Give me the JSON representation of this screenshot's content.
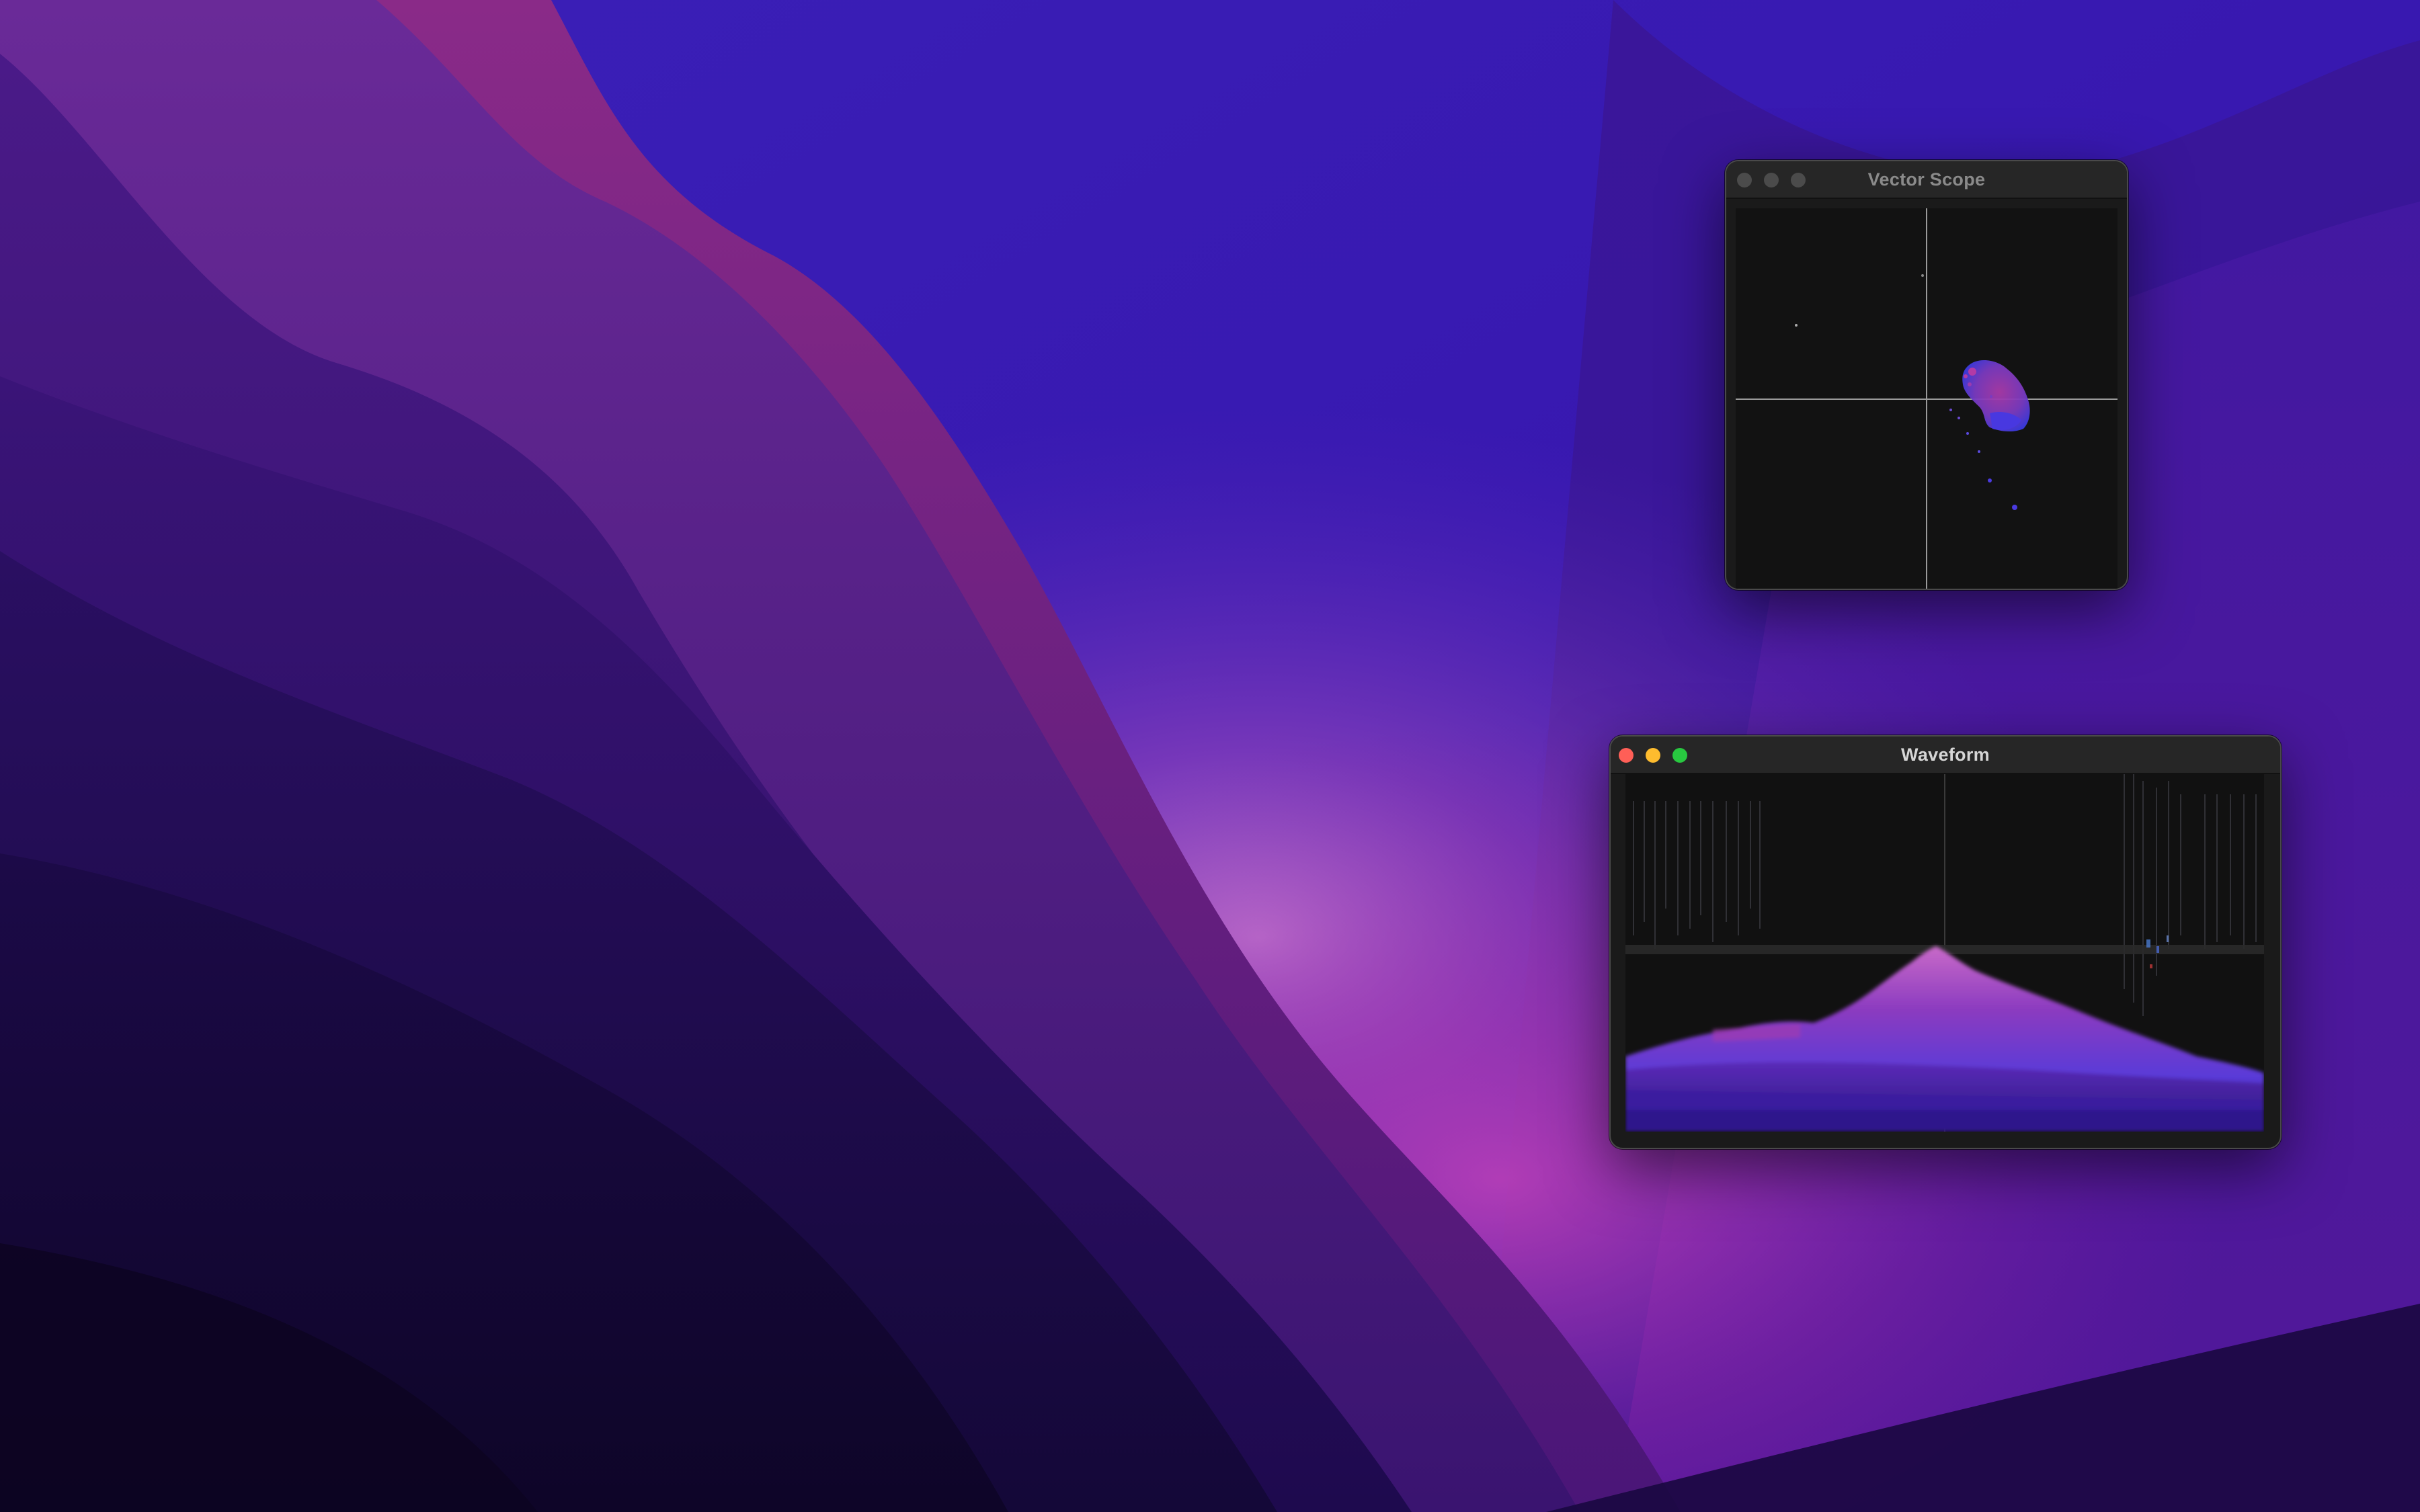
{
  "desktop": {
    "wallpaper_colors": {
      "deep": "#120830",
      "indigo": "#2a1aa8",
      "violet": "#5a2ab8",
      "magenta": "#9a2aa0",
      "glow": "#c070d0"
    }
  },
  "windows": {
    "vector_scope": {
      "title": "Vector Scope",
      "state": "inactive",
      "buttons": [
        "close",
        "minimize",
        "zoom"
      ]
    },
    "waveform": {
      "title": "Waveform",
      "state": "active",
      "buttons": [
        "close",
        "minimize",
        "zoom"
      ]
    }
  },
  "colors": {
    "window_bg": "#1a1a1a",
    "titlebar_bg": "#262626",
    "scope_bg": "#121212",
    "graticule": "#8a8a8a",
    "trace_magenta": "#b23aa6",
    "trace_blue": "#4a3ae0",
    "close_red": "#ff5f57",
    "minimize_yellow": "#febc2e",
    "zoom_green": "#28c840"
  }
}
